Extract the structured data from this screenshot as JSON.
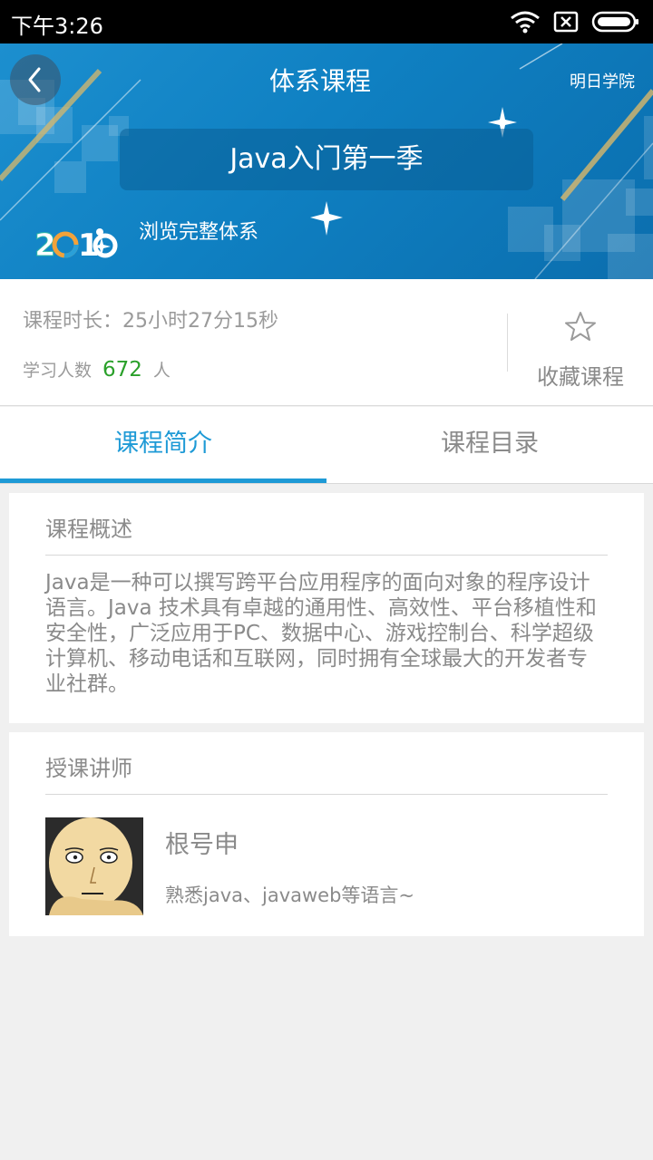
{
  "status_bar": {
    "time": "下午3:26"
  },
  "header": {
    "title": "体系课程",
    "brand": "明日学院"
  },
  "course": {
    "name": "Java入门第一季",
    "browse_link": "浏览完整体系"
  },
  "info": {
    "duration": "课程时长：25小时27分15秒",
    "learners_prefix": "学习人数",
    "learners_count": "672",
    "learners_suffix": "人",
    "favorite_label": "收藏课程"
  },
  "tabs": [
    {
      "label": "课程简介",
      "active": true
    },
    {
      "label": "课程目录",
      "active": false
    }
  ],
  "overview": {
    "title": "课程概述",
    "text": "Java是一种可以撰写跨平台应用程序的面向对象的程序设计语言。Java 技术具有卓越的通用性、高效性、平台移植性和安全性，广泛应用于PC、数据中心、游戏控制台、科学超级计算机、移动电话和互联网，同时拥有全球最大的开发者专业社群。"
  },
  "teacher": {
    "section_title": "授课讲师",
    "name": "根号申",
    "description": "熟悉java、javaweb等语言~"
  },
  "colors": {
    "accent": "#1e9ad6",
    "count_green": "#2aa02a",
    "banner": "#0f80c2"
  },
  "icons": [
    "wifi-icon",
    "sim-card-icon",
    "battery-icon",
    "back-chevron-icon",
    "star-outline-icon",
    "logo-2016"
  ]
}
